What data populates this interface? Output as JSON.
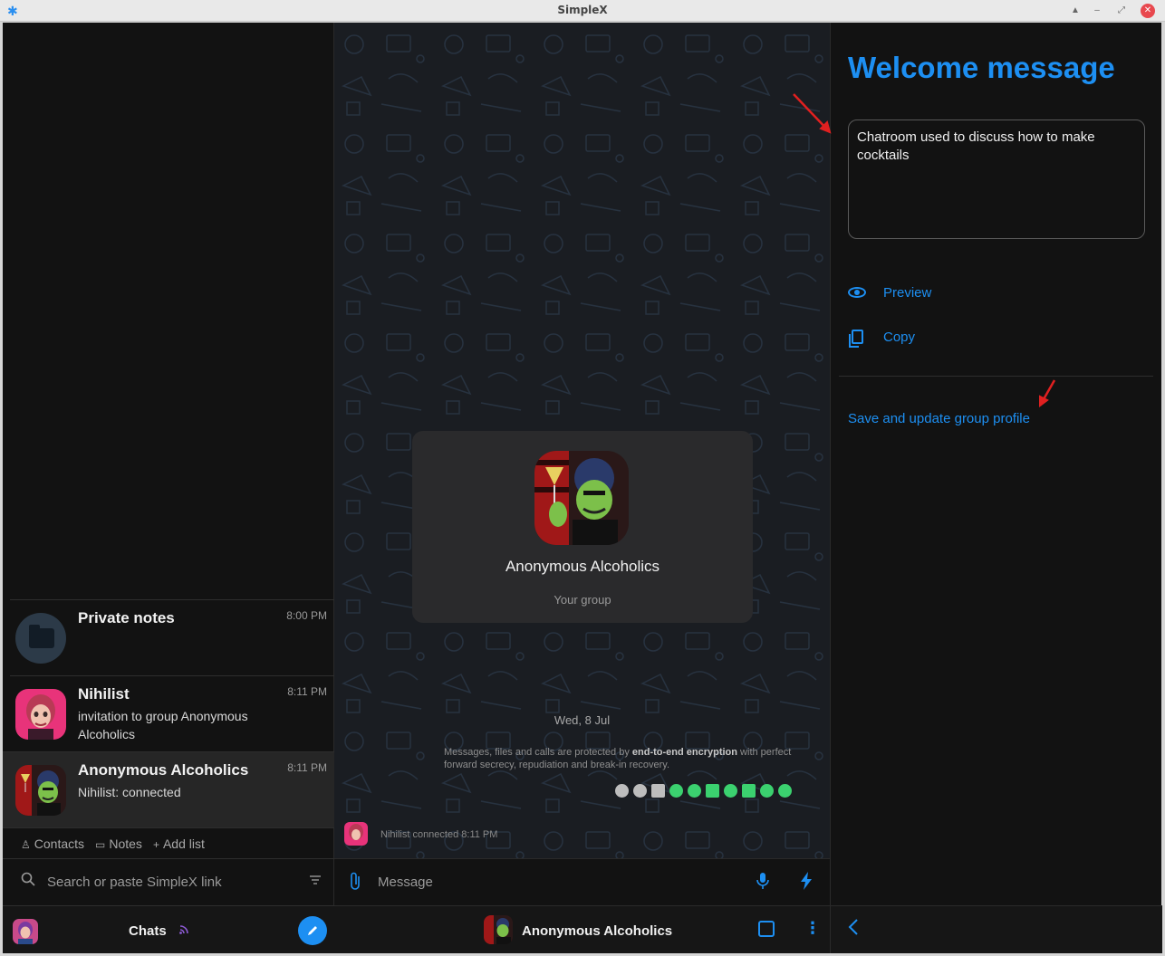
{
  "window": {
    "title": "SimpleX",
    "controls": [
      "▲",
      "–",
      "⤢",
      "✕"
    ]
  },
  "chat_list": {
    "items": [
      {
        "name": "Private notes",
        "time": "8:00 PM",
        "preview": ""
      },
      {
        "name": "Nihilist",
        "time": "8:11 PM",
        "preview": "invitation to group Anonymous Alcoholics"
      },
      {
        "name": "Anonymous Alcoholics",
        "time": "8:11 PM",
        "preview": "Nihilist: connected"
      }
    ],
    "filters": [
      {
        "icon": "♙",
        "label": "Contacts"
      },
      {
        "icon": "▭",
        "label": "Notes"
      },
      {
        "icon": "+",
        "label": "Add list"
      }
    ],
    "search_placeholder": "Search or paste SimpleX link",
    "bottom_label": "Chats"
  },
  "chat": {
    "group_name": "Anonymous Alcoholics",
    "group_sub": "Your group",
    "date": "Wed, 8 Jul",
    "e2e_prefix": "Messages, files and calls are protected by ",
    "e2e_bold": "end-to-end encryption",
    "e2e_suffix": " with perfect forward secrecy, repudiation and break-in recovery.",
    "event_text": "Nihilist connected  8:11 PM",
    "composer_placeholder": "Message",
    "header_title": "Anonymous Alcoholics"
  },
  "welcome": {
    "heading": "Welcome message",
    "text": "Chatroom used to discuss how to make cocktails",
    "preview_label": "Preview",
    "copy_label": "Copy",
    "save_label": "Save and update group profile"
  },
  "colors": {
    "accent": "#1d8ff2",
    "background": "#121212",
    "feature_green": "#3bd16f",
    "annotation_arrow": "#e02020"
  }
}
